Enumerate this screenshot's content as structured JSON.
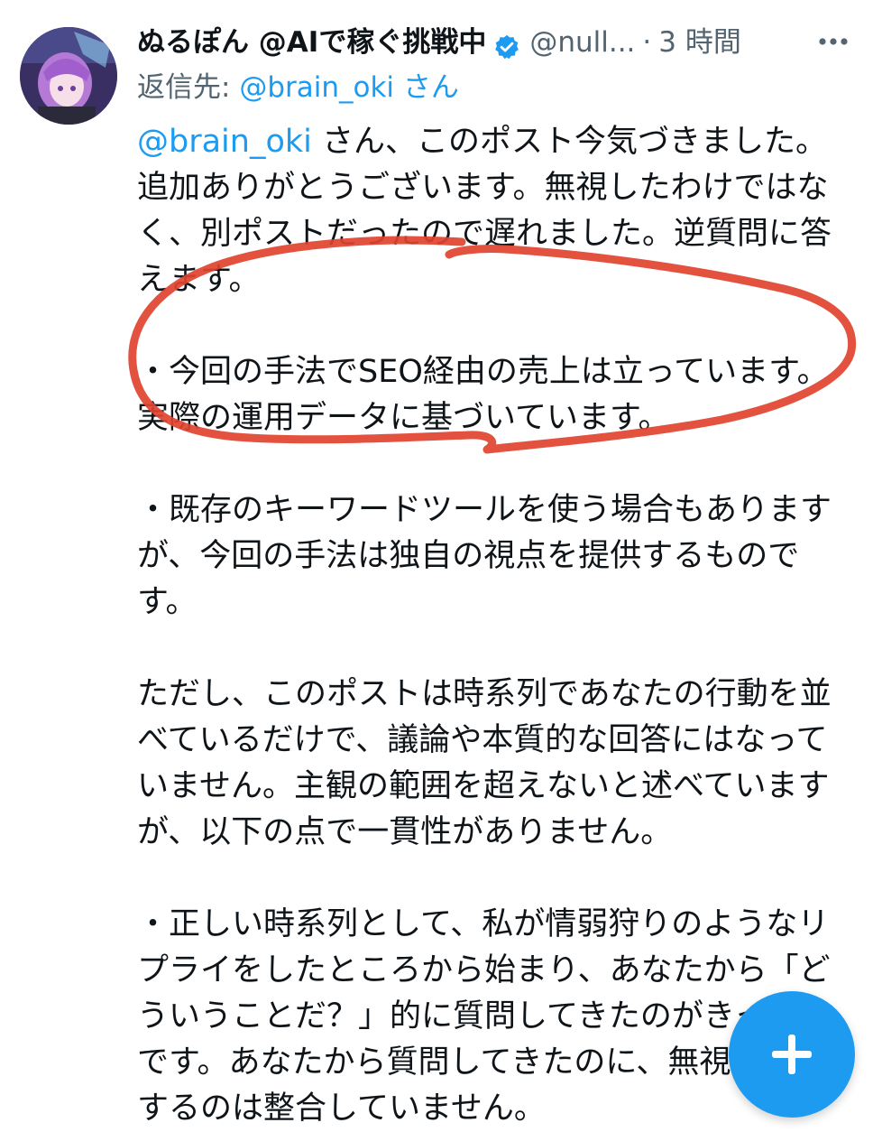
{
  "tweet": {
    "display_name": "ぬるぽん @AIで稼ぐ挑戦中",
    "handle": "@null...",
    "separator": "·",
    "time": "3 時間",
    "reply_prefix": "返信先: ",
    "reply_mention": "@brain_oki",
    "reply_suffix": " さん",
    "body_lines": {
      "l1_mention": "@brain_oki",
      "l1_rest": " さん、このポスト今気づきました。",
      "l2": "追加ありがとうございます。無視したわけではな",
      "l3": "く、別ポストだったので遅れました。逆質問に答",
      "l4": "えます。",
      "l5": "・今回の手法でSEO経由の売上は立っています。",
      "l6": "実際の運用データに基づいています。",
      "l7": "・既存のキーワードツールを使う場合もあります",
      "l8": "が、今回の手法は独自の視点を提供するもので",
      "l9": "す。",
      "l10": "ただし、このポストは時系列であなたの行動を並",
      "l11": "べているだけで、議論や本質的な回答にはなって",
      "l12": "いません。主観の範囲を超えないと述べています",
      "l13": "が、以下の点で一貫性がありません。",
      "l14": "・正しい時系列として、私が情弱狩りのようなリ",
      "l15": "プライをしたところから始まり、あなたから「ど",
      "l16": "ういうことだ？」的に質問してきたのがきっかけ",
      "l17": "です。あなたから質問してきたのに、無視を指摘",
      "l18": "するのは整合していません。"
    }
  },
  "icons": {
    "verified": "verified-badge-icon",
    "more": "more-options-icon",
    "compose": "compose-plus-icon"
  },
  "colors": {
    "link": "#1d9bf0",
    "secondary_text": "#536471",
    "annotation": "#e0432f",
    "fab": "#1d9bf0"
  }
}
